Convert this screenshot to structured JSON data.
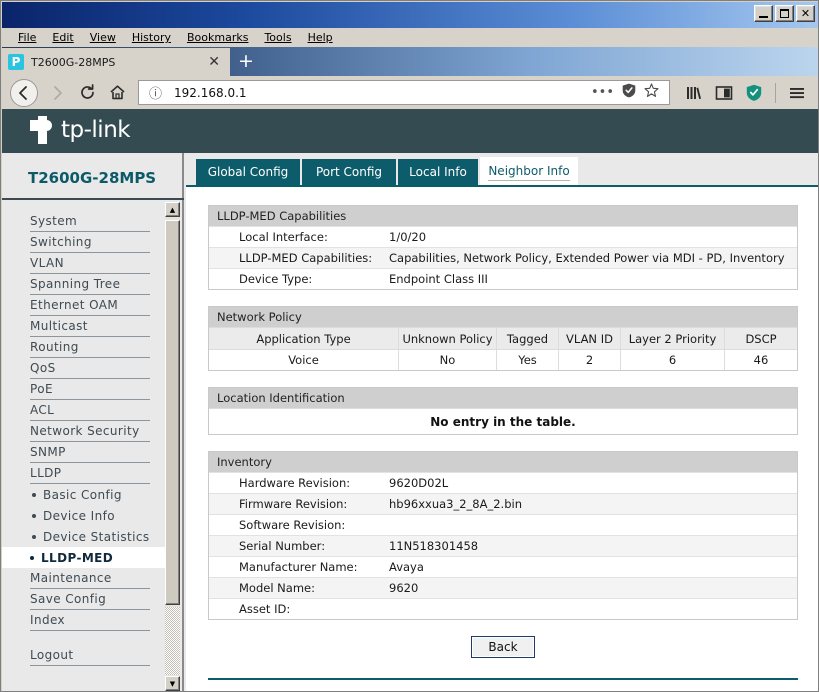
{
  "window": {
    "minimize_label": "_",
    "maximize_label": "□",
    "close_label": "✕"
  },
  "browser": {
    "menus": [
      "File",
      "Edit",
      "View",
      "History",
      "Bookmarks",
      "Tools",
      "Help"
    ],
    "tab": {
      "title": "T2600G-28MPS",
      "close_label": "✕",
      "favicon": "tplink-favicon"
    },
    "new_tab_label": "+",
    "nav": {
      "back_label": "←",
      "forward_label": "→",
      "reload_label": "⟳",
      "home_label": "⌂"
    },
    "url": {
      "value": "192.168.0.1",
      "info_icon": "ⓘ",
      "more_icon": "•••",
      "shield_icon": "shield",
      "bookmark_icon": "☆"
    },
    "toolbar_icons": [
      "library-icon",
      "sidebar-icon",
      "shield-icon",
      "menu-icon"
    ]
  },
  "brand": {
    "name": "tp-link"
  },
  "sidebar": {
    "device_name": "T2600G-28MPS",
    "items": [
      {
        "label": "System",
        "type": "top"
      },
      {
        "label": "Switching",
        "type": "top"
      },
      {
        "label": "VLAN",
        "type": "top"
      },
      {
        "label": "Spanning Tree",
        "type": "top"
      },
      {
        "label": "Ethernet OAM",
        "type": "top"
      },
      {
        "label": "Multicast",
        "type": "top"
      },
      {
        "label": "Routing",
        "type": "top"
      },
      {
        "label": "QoS",
        "type": "top"
      },
      {
        "label": "PoE",
        "type": "top"
      },
      {
        "label": "ACL",
        "type": "top"
      },
      {
        "label": "Network Security",
        "type": "top"
      },
      {
        "label": "SNMP",
        "type": "top"
      },
      {
        "label": "LLDP",
        "type": "top"
      },
      {
        "label": "Basic Config",
        "type": "sub"
      },
      {
        "label": "Device Info",
        "type": "sub"
      },
      {
        "label": "Device Statistics",
        "type": "sub"
      },
      {
        "label": "LLDP-MED",
        "type": "sub-active"
      },
      {
        "label": "Maintenance",
        "type": "top"
      },
      {
        "label": "Save Config",
        "type": "top"
      },
      {
        "label": "Index",
        "type": "top"
      },
      {
        "label": "",
        "type": "spacer"
      },
      {
        "label": "Logout",
        "type": "top"
      }
    ]
  },
  "content": {
    "tabs": [
      {
        "label": "Global Config",
        "active": false
      },
      {
        "label": "Port Config",
        "active": false
      },
      {
        "label": "Local Info",
        "active": false
      },
      {
        "label": "Neighbor Info",
        "active": true
      }
    ],
    "capabilities": {
      "title": "LLDP-MED Capabilities",
      "rows": [
        {
          "label": "Local Interface:",
          "value": "1/0/20"
        },
        {
          "label": "LLDP-MED Capabilities:",
          "value": "Capabilities, Network Policy, Extended Power via MDI - PD, Inventory"
        },
        {
          "label": "Device Type:",
          "value": "Endpoint Class III"
        }
      ]
    },
    "network_policy": {
      "title": "Network Policy",
      "headers": [
        "Application Type",
        "Unknown Policy",
        "Tagged",
        "VLAN ID",
        "Layer 2 Priority",
        "DSCP"
      ],
      "rows": [
        {
          "application_type": "Voice",
          "unknown_policy": "No",
          "tagged": "Yes",
          "vlan_id": "2",
          "layer2_priority": "6",
          "dscp": "46"
        }
      ]
    },
    "location_identification": {
      "title": "Location Identification",
      "empty_message": "No entry in the table."
    },
    "inventory": {
      "title": "Inventory",
      "rows": [
        {
          "label": "Hardware Revision:",
          "value": "9620D02L"
        },
        {
          "label": "Firmware Revision:",
          "value": "hb96xxua3_2_8A_2.bin"
        },
        {
          "label": "Software Revision:",
          "value": ""
        },
        {
          "label": "Serial Number:",
          "value": "11N518301458"
        },
        {
          "label": "Manufacturer Name:",
          "value": "Avaya"
        },
        {
          "label": "Model Name:",
          "value": "9620"
        },
        {
          "label": "Asset ID:",
          "value": ""
        }
      ]
    },
    "back_button_label": "Back"
  },
  "colors": {
    "brand_teal": "#0d5c6b",
    "header_dark": "#344b52",
    "title_blue": "#0a246a",
    "favicon_cyan": "#2bc4e0"
  }
}
